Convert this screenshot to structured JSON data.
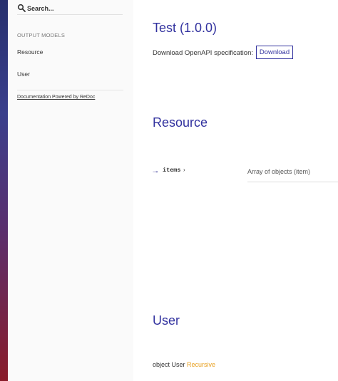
{
  "sidebar": {
    "search": {
      "placeholder": "Search..."
    },
    "section_label": "OUTPUT MODELS",
    "items": [
      {
        "label": "Resource"
      },
      {
        "label": "User"
      }
    ],
    "powered_by": "Documentation Powered by ReDoc"
  },
  "main": {
    "title": "Test (1.0.0)",
    "download_label": "Download OpenAPI specification:",
    "download_button": "Download",
    "sections": [
      {
        "title": "Resource",
        "property": {
          "name": "items",
          "chevron": "›",
          "type": "Array of objects (item)"
        }
      },
      {
        "title": "User",
        "desc_prefix": "object User",
        "desc_recursive": "Recursive"
      }
    ]
  },
  "colors": {
    "accent": "#32329f",
    "recursive": "#e8a020"
  },
  "icons": {
    "search": "search-icon",
    "property_line": "property-connector-icon"
  }
}
